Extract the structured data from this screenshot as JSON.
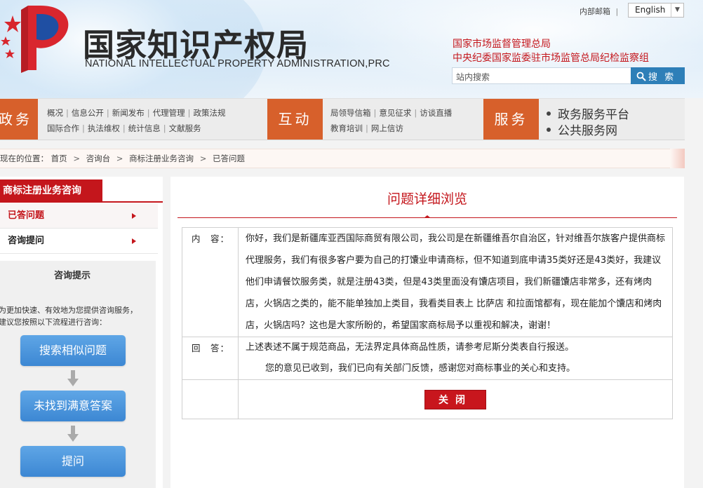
{
  "header": {
    "logo_cn": "国家知识产权局",
    "logo_en": "NATIONAL INTELLECTUAL PROPERTY ADMINISTRATION,PRC",
    "mail_link": "内部邮箱",
    "mail_sep": "|",
    "language": "English",
    "org_line1": "国家市场监督管理总局",
    "org_line2": "中央纪委国家监委驻市场监管总局纪检监察组",
    "search_placeholder": "站内搜索",
    "search_button": "搜 索"
  },
  "nav": {
    "tag1": "政务",
    "tag1_links_row1": [
      "概况",
      "信息公开",
      "新闻发布",
      "代理管理",
      "政策法规"
    ],
    "tag1_links_row2": [
      "国际合作",
      "执法维权",
      "统计信息",
      "文献服务"
    ],
    "tag2": "互动",
    "tag2_links_row1": [
      "局领导信箱",
      "意见征求",
      "访谈直播"
    ],
    "tag2_links_row2": [
      "教育培训",
      "网上信访"
    ],
    "tag3": "服务",
    "service_items": [
      "政务服务平台",
      "公共服务网"
    ]
  },
  "breadcrumb": {
    "prefix": "现在的位置：",
    "items": [
      "首页",
      "咨询台",
      "商标注册业务咨询",
      "已答问题"
    ],
    "separator": ">"
  },
  "sidebar": {
    "title": "商标注册业务咨询",
    "items": [
      "已答问题",
      "咨询提问"
    ],
    "tips_title": "咨询提示",
    "tips_text_line1": "为更加快速、有效地为您提供咨询服务，",
    "tips_text_line2": "建议您按照以下流程进行咨询：",
    "flow": [
      "搜索相似问题",
      "未找到满意答案",
      "提问"
    ]
  },
  "main": {
    "title": "问题详细浏览",
    "content_label": "内　容：",
    "content_text": "你好，我们是新疆库亚西国际商贸有限公司，我公司是在新疆维吾尔自治区，针对维吾尔族客户提供商标代理服务，我们有很多客户要为自己的打馕业申请商标，但不知道到底申请35类好还是43类好，我建议他们申请餐饮服务类，就是注册43类，但是43类里面没有馕店项目，我们新疆馕店非常多，还有烤肉店，火锅店之类的，能不能单独加上类目，我看类目表上 比萨店 和拉面馆都有，现在能加个馕店和烤肉店，火锅店吗？这也是大家所盼的，希望国家商标局予以重视和解决，谢谢！",
    "answer_label": "回　答：",
    "answer_line1": "上述表述不属于规范商品，无法界定具体商品性质，请参考尼斯分类表自行报送。",
    "answer_line2": "您的意见已收到，我们已向有关部门反馈，感谢您对商标事业的关心和支持。",
    "close_button": "关闭"
  },
  "colors": {
    "brand_red": "#c4161c",
    "nav_orange": "#d7602b",
    "search_blue": "#2e7fb8",
    "flow_blue": "#4a95dc"
  }
}
